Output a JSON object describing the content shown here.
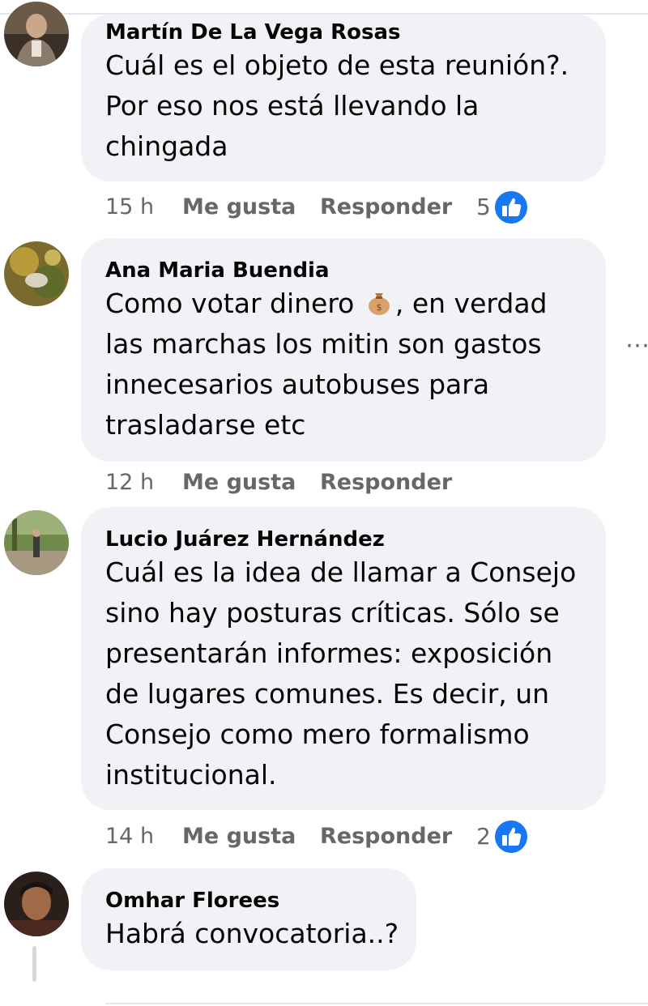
{
  "comments": [
    {
      "author": "Martín De La Vega Rosas",
      "lines": [
        "Cuál es el objeto de esta reunión?.",
        "Por eso nos está llevando la",
        "chingada"
      ],
      "time": "15 h",
      "like_label": "Me gusta",
      "reply_label": "Responder",
      "reaction_count": "5",
      "avatar_icon": "avatar-photo-man"
    },
    {
      "author": "Ana Maria Buendia",
      "line1_before_emoji": "Como votar dinero ",
      "line1_emoji_icon": "money-bag-icon",
      "line1_after_emoji": ", en verdad",
      "lines_rest": [
        "las marchas los mitin son gastos",
        "innecesarios autobuses para",
        "trasladarse etc"
      ],
      "time": "12 h",
      "like_label": "Me gusta",
      "reply_label": "Responder",
      "avatar_icon": "avatar-photo-nature"
    },
    {
      "author": "Lucio Juárez Hernández",
      "lines": [
        "Cuál es la idea de llamar a Consejo",
        "sino hay posturas críticas. Sólo se",
        "presentarán informes: exposición",
        "de lugares comunes. Es decir, un",
        "Consejo como mero formalismo",
        "institucional."
      ],
      "time": "14 h",
      "like_label": "Me gusta",
      "reply_label": "Responder",
      "reaction_count": "2",
      "avatar_icon": "avatar-photo-park"
    },
    {
      "author": "Omhar Florees",
      "lines": [
        "Habrá convocatoria..?"
      ],
      "avatar_icon": "avatar-photo-selfie"
    }
  ],
  "colors": {
    "bubble": "#f0f2f5",
    "meta_text": "#65676b",
    "like_blue": "#1877f2"
  },
  "more_icon": "more-options-icon"
}
